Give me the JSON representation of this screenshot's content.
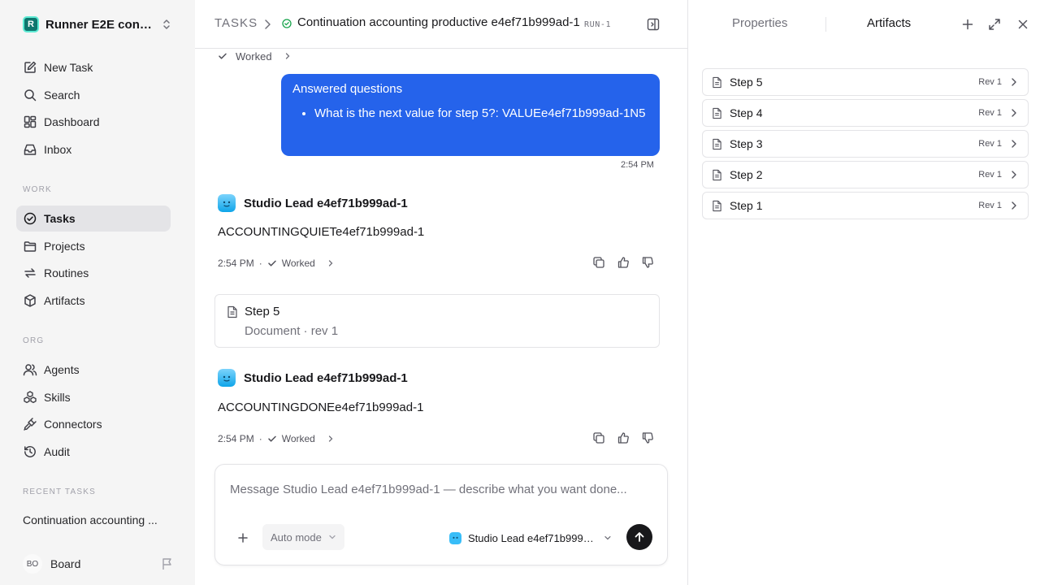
{
  "sidebar": {
    "workspace": {
      "name": "Runner E2E conti...",
      "logo_letter": "R"
    },
    "nav": [
      {
        "id": "new-task",
        "label": "New Task",
        "icon": "pencil-square-icon"
      },
      {
        "id": "search",
        "label": "Search",
        "icon": "search-icon"
      },
      {
        "id": "dashboard",
        "label": "Dashboard",
        "icon": "dashboard-icon"
      },
      {
        "id": "inbox",
        "label": "Inbox",
        "icon": "inbox-icon"
      }
    ],
    "work_label": "WORK",
    "work": [
      {
        "id": "tasks",
        "label": "Tasks",
        "icon": "check-circle-icon",
        "active": true
      },
      {
        "id": "projects",
        "label": "Projects",
        "icon": "folder-icon"
      },
      {
        "id": "routines",
        "label": "Routines",
        "icon": "repeat-icon"
      },
      {
        "id": "artifacts",
        "label": "Artifacts",
        "icon": "cube-icon"
      }
    ],
    "org_label": "ORG",
    "org": [
      {
        "id": "agents",
        "label": "Agents",
        "icon": "users-icon"
      },
      {
        "id": "skills",
        "label": "Skills",
        "icon": "boxes-icon"
      },
      {
        "id": "connectors",
        "label": "Connectors",
        "icon": "plug-icon"
      },
      {
        "id": "audit",
        "label": "Audit",
        "icon": "history-icon"
      }
    ],
    "recent_label": "RECENT TASKS",
    "recent": [
      "Continuation accounting ..."
    ],
    "board": {
      "initials": "BO",
      "label": "Board"
    }
  },
  "header": {
    "root": "TASKS",
    "title": "Continuation accounting productive e4ef71b999ad-1",
    "run_tag": "RUN-1"
  },
  "thread": {
    "worked_top": "Worked",
    "user_message": {
      "title": "Answered questions",
      "items": [
        "What is the next value for step 5?: VALUEe4ef71b999ad-1N5"
      ],
      "time": "2:54 PM"
    },
    "messages": [
      {
        "agent": "Studio Lead e4ef71b999ad-1",
        "body": "ACCOUNTINGQUIETe4ef71b999ad-1",
        "time": "2:54 PM",
        "status": "Worked"
      },
      {
        "agent": "Studio Lead e4ef71b999ad-1",
        "body": "ACCOUNTINGDONEe4ef71b999ad-1",
        "time": "2:54 PM",
        "status": "Worked"
      }
    ],
    "doc_card": {
      "title": "Step 5",
      "subtitle": "Document · rev 1"
    }
  },
  "composer": {
    "placeholder": "Message Studio Lead e4ef71b999ad-1 — describe what you want done...",
    "mode": "Auto mode",
    "agent": "Studio Lead e4ef71b999ad-1"
  },
  "panel": {
    "tabs": [
      "Properties",
      "Artifacts"
    ],
    "active_tab": "Artifacts",
    "artifacts": [
      {
        "name": "Step 5",
        "rev": "Rev 1"
      },
      {
        "name": "Step 4",
        "rev": "Rev 1"
      },
      {
        "name": "Step 3",
        "rev": "Rev 1"
      },
      {
        "name": "Step 2",
        "rev": "Rev 1"
      },
      {
        "name": "Step 1",
        "rev": "Rev 1"
      }
    ]
  },
  "colors": {
    "accent": "#2563eb",
    "status_ok": "#16a34a",
    "sidebar_bg": "#f5f5f5"
  }
}
